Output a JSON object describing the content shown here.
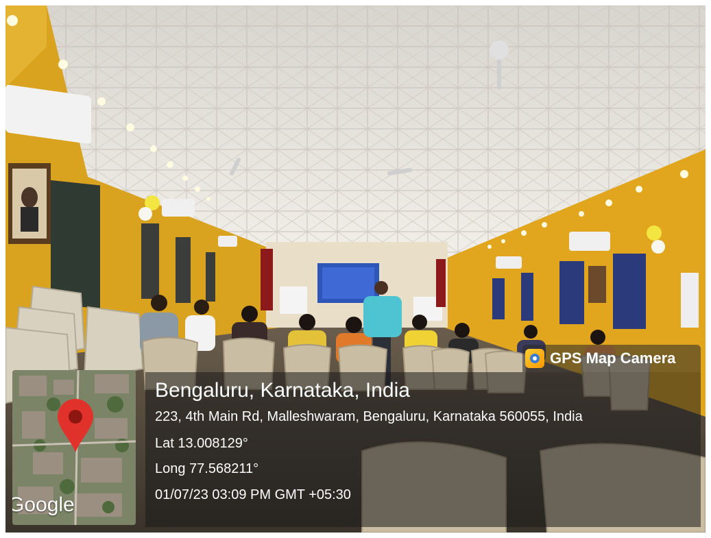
{
  "watermark": {
    "brand": "GPS Map Camera",
    "icon": "camera-pin-icon",
    "map_attribution": "Google"
  },
  "location": {
    "city_line": "Bengaluru, Karnataka, India",
    "address": "223, 4th Main Rd, Malleshwaram, Bengaluru, Karnataka 560055, India",
    "latitude": "Lat 13.008129°",
    "longitude": "Long 77.568211°",
    "datetime": "01/07/23 03:09 PM GMT +05:30"
  },
  "colors": {
    "wall": "#d9a21f",
    "ceiling": "#e9e6e0",
    "pin": "#e0322b"
  }
}
